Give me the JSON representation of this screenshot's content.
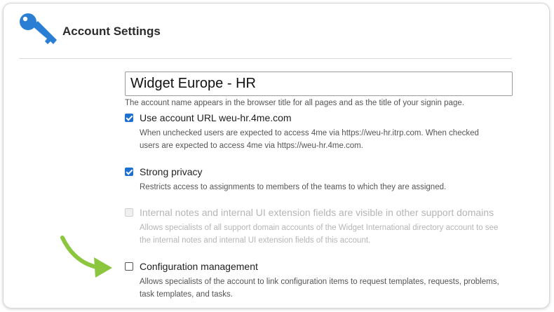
{
  "header": {
    "title": "Account Settings",
    "icon": "key-icon",
    "icon_color": "#2a7fd4"
  },
  "account_name": {
    "value": "Widget Europe - HR",
    "help": "The account name appears in the browser title for all pages and as the title of your signin page."
  },
  "options": [
    {
      "label": "Use account URL weu-hr.4me.com",
      "description": "When unchecked users are expected to access 4me via https://weu-hr.itrp.com. When checked users are expected to access 4me via https://weu-hr.4me.com.",
      "checked": true,
      "disabled": false
    },
    {
      "label": "Strong privacy",
      "description": "Restricts access to assignments to members of the teams to which they are assigned.",
      "checked": true,
      "disabled": false
    },
    {
      "label": "Internal notes and internal UI extension fields are visible in other support domains",
      "description": "Allows specialists of all support domain accounts of the Widget International directory account to see the internal notes and internal UI extension fields of this account.",
      "checked": false,
      "disabled": true
    },
    {
      "label": "Configuration management",
      "description": "Allows specialists of the account to link configuration items to request templates, requests, problems, task templates, and tasks.",
      "checked": false,
      "disabled": false
    }
  ],
  "colors": {
    "accent": "#1f6fd1",
    "arrow": "#8cc63f"
  }
}
